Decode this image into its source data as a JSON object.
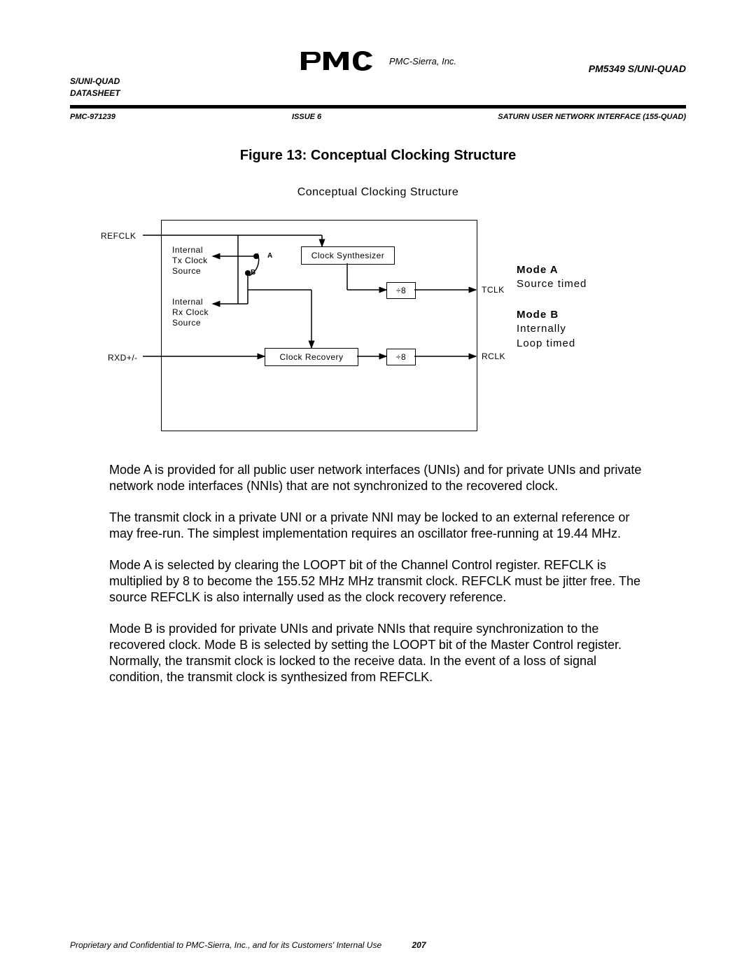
{
  "header": {
    "left_line1": "S/UNI-QUAD",
    "left_line2": "DATASHEET",
    "company": "PMC-Sierra, Inc.",
    "right": "PM5349 S/UNI-QUAD"
  },
  "subheader": {
    "left": "PMC-971239",
    "mid": "ISSUE 6",
    "right": "SATURN USER NETWORK INTERFACE (155-QUAD)"
  },
  "figure": {
    "title": "Figure 13:  Conceptual Clocking Structure",
    "subtitle": "Conceptual Clocking Structure",
    "labels": {
      "refclk": "REFCLK",
      "rxd": "RXD+/-",
      "tclk": "TCLK",
      "rclk": "RCLK",
      "int_tx": "Internal\nTx Clock\nSource",
      "int_rx": "Internal\nRx Clock\nSource",
      "synth": "Clock Synthesizer",
      "recov": "Clock Recovery",
      "div8a": "÷8",
      "div8b": "÷8",
      "sel_a": "A",
      "sel_b": "B"
    },
    "modes": {
      "a_name": "Mode A",
      "a_desc": "Source timed",
      "b_name": "Mode B",
      "b_desc1": "Internally",
      "b_desc2": "Loop timed"
    }
  },
  "paragraphs": {
    "p1": "Mode A is provided for all public user network interfaces (UNIs) and for private UNIs and private network node interfaces (NNIs) that are not synchronized to the recovered clock.",
    "p2": "The transmit clock in a private UNI or a private NNI may be locked to an external reference or may free-run.  The simplest implementation requires an oscillator free-running at 19.44 MHz.",
    "p3": "Mode A is selected by clearing the LOOPT bit of the Channel Control register.  REFCLK is multiplied by 8 to become the 155.52 MHz MHz transmit clock.  REFCLK must be jitter free.  The source REFCLK is also internally used as the clock recovery reference.",
    "p4": "Mode B is provided for private UNIs and private NNIs that require synchronization to the recovered clock. Mode B is selected by setting the LOOPT bit of the Master Control register.  Normally, the transmit clock is locked to the receive data.  In the event of a loss of signal condition, the transmit clock is synthesized from REFCLK."
  },
  "footer": {
    "text": "Proprietary and Confidential to PMC-Sierra, Inc., and for its Customers' Internal Use",
    "page": "207"
  }
}
